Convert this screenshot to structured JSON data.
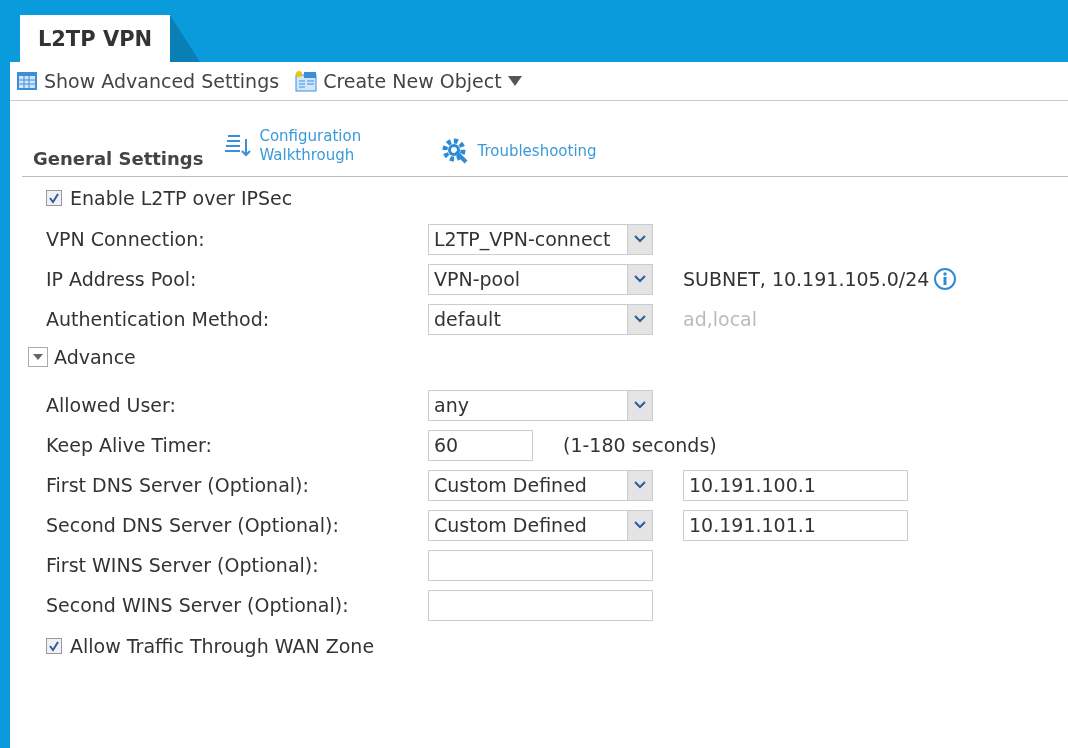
{
  "tab": {
    "label": "L2TP VPN",
    "selected": true
  },
  "toolbar": [
    {
      "kind": "table",
      "label": "Show Advanced Settings"
    },
    {
      "kind": "object",
      "label": "Create New Object",
      "dropdown": true
    }
  ],
  "section": {
    "title": "General Settings",
    "links": [
      {
        "kind": "walkthrough",
        "label": "Configuration Walkthrough"
      },
      {
        "kind": "troubleshoot",
        "label": "Troubleshooting"
      }
    ]
  },
  "enable": {
    "label": "Enable L2TP over IPSec",
    "checked": true
  },
  "rows": [
    {
      "kind": "select",
      "label": "VPN Connection:",
      "value": "L2TP_VPN-connect"
    },
    {
      "kind": "select",
      "label": "IP Address Pool:",
      "value": "VPN-pool",
      "note": "SUBNET, 10.191.105.0/24",
      "info": true
    },
    {
      "kind": "select",
      "label": "Authentication Method:",
      "value": "default",
      "note": "ad,local",
      "muted": true
    }
  ],
  "advance": {
    "label": "Advance",
    "expanded": true
  },
  "advanced_rows": [
    {
      "kind": "select",
      "label": "Allowed User:",
      "value": "any"
    },
    {
      "kind": "short_input",
      "label": "Keep Alive Timer:",
      "value": "60",
      "note": "(1-180 seconds)"
    },
    {
      "kind": "select",
      "label": "First DNS Server (Optional):",
      "value": "Custom Defined",
      "extra_value": "10.191.100.1"
    },
    {
      "kind": "select",
      "label": "Second DNS Server (Optional):",
      "value": "Custom Defined",
      "extra_value": "10.191.101.1"
    },
    {
      "kind": "input",
      "label": "First WINS Server (Optional):"
    },
    {
      "kind": "input",
      "label": "Second WINS Server (Optional):"
    }
  ],
  "allow": {
    "label": "Allow Traffic Through WAN Zone",
    "checked": true
  }
}
